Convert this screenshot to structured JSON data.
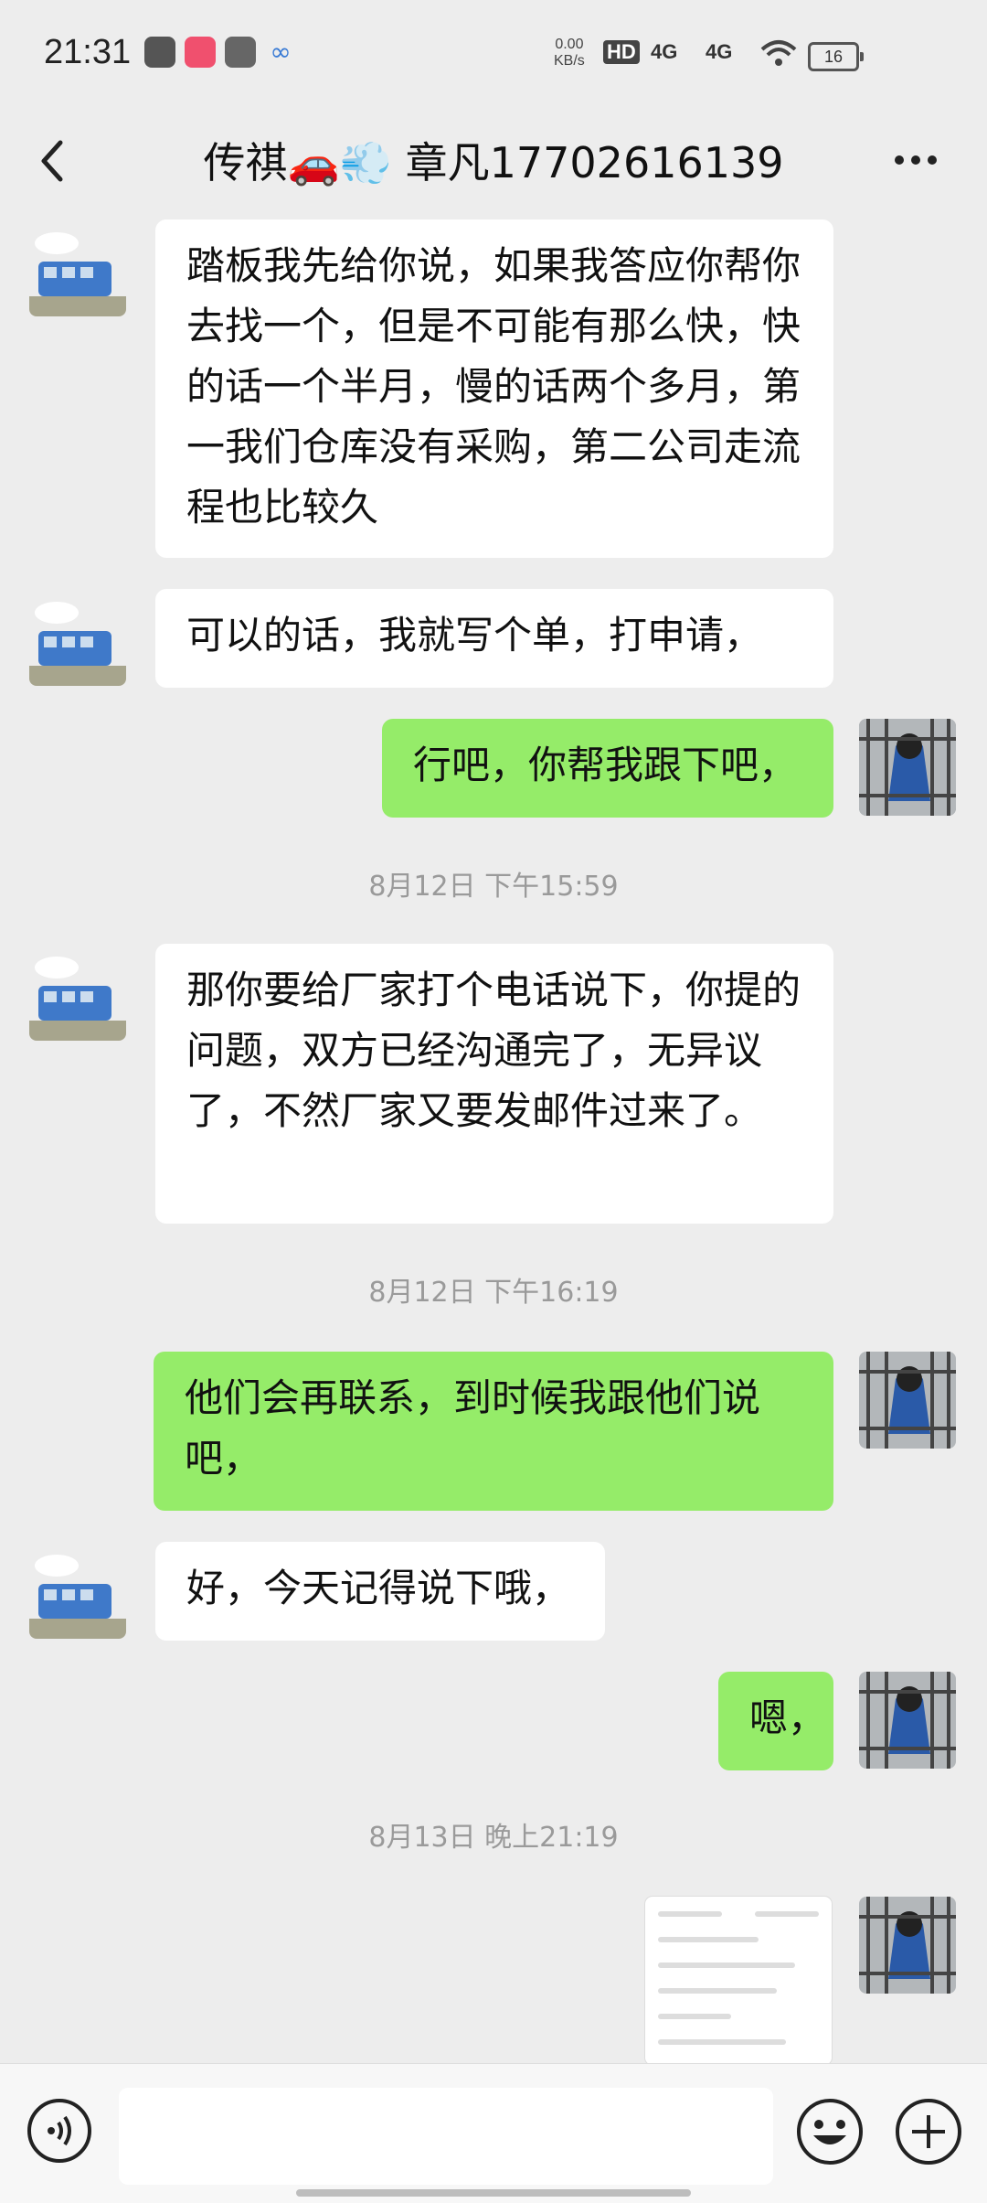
{
  "status_bar": {
    "time": "21:31",
    "net_speed_value": "0.00",
    "net_speed_unit": "KB/s",
    "hd": "HD",
    "signal1": "4G",
    "signal2": "4G",
    "battery": "16"
  },
  "header": {
    "title": "传祺🚗💨 章凡17702616139"
  },
  "messages": [
    {
      "side": "in",
      "text": "踏板我先给你说，如果我答应你帮你去找一个，但是不可能有那么快，快的话一个半月，慢的话两个多月，第一我们仓库没有采购，第二公司走流程也比较久"
    },
    {
      "side": "in",
      "text": "可以的话，我就写个单，打申请，"
    },
    {
      "side": "out",
      "text": "行吧，你帮我跟下吧，"
    },
    {
      "side": "in",
      "text": "那你要给厂家打个电话说下，你提的问题，双方已经沟通完了，无异议了，不然厂家又要发邮件过来了。"
    },
    {
      "side": "out",
      "text": "他们会再联系，到时候我跟他们说吧，"
    },
    {
      "side": "in",
      "text": "好，今天记得说下哦，"
    },
    {
      "side": "out",
      "text": "嗯，"
    }
  ],
  "timestamps": [
    "8月12日 下午15:59",
    "8月12日 下午16:19",
    "8月13日 晚上21:19"
  ],
  "input": {
    "placeholder": ""
  }
}
